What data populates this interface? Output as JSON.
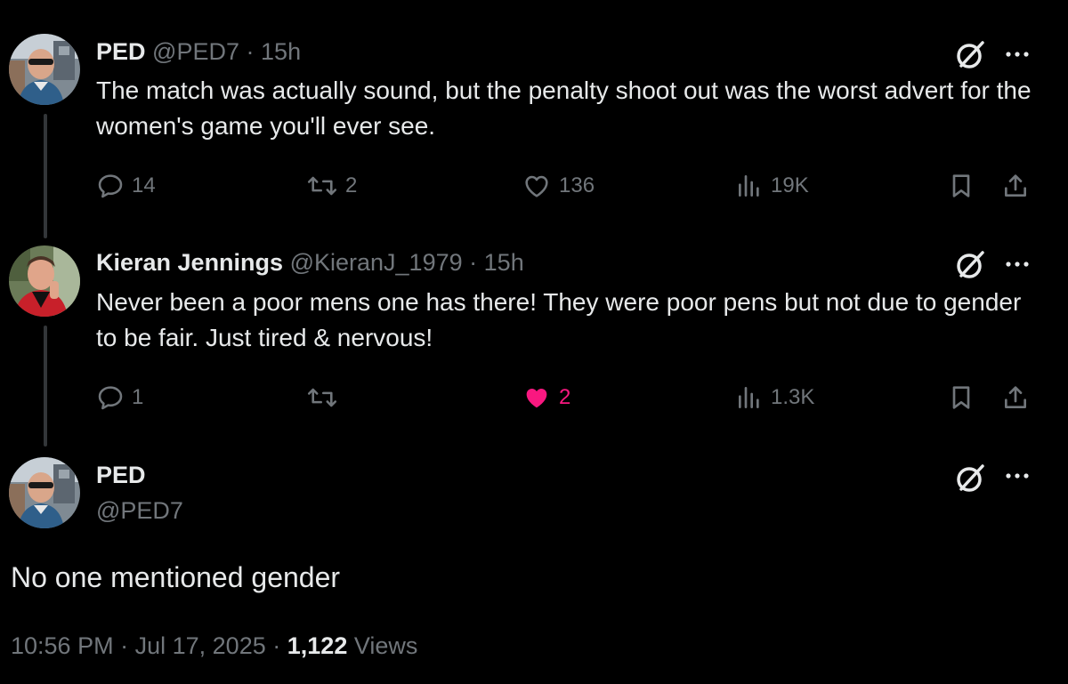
{
  "tweets": [
    {
      "name": "PED",
      "handle": "@PED7",
      "sep": "·",
      "time": "15h",
      "text": "The match was actually sound, but the penalty shoot out was the worst advert for the women's game you'll ever see.",
      "replies": "14",
      "retweets": "2",
      "likes": "136",
      "views": "19K"
    },
    {
      "name": "Kieran Jennings",
      "handle": "@KieranJ_1979",
      "sep": "·",
      "time": "15h",
      "text": "Never been a poor mens one has there! They were poor pens but not due to gender to be fair. Just tired & nervous!",
      "replies": "1",
      "retweets": "",
      "likes": "2",
      "views": "1.3K"
    }
  ],
  "main_tweet": {
    "name": "PED",
    "handle": "@PED7",
    "text": "No one mentioned gender",
    "time": "10:56 PM",
    "sep": "·",
    "date": "Jul 17, 2025",
    "views_count": "1,122",
    "views_label": "Views"
  },
  "icons": {
    "reply": "reply-icon",
    "retweet": "retweet-icon",
    "like": "heart-icon",
    "views": "views-icon",
    "bookmark": "bookmark-icon",
    "share": "share-icon",
    "grok": "grok-icon",
    "more": "more-icon"
  },
  "colors": {
    "background": "#000000",
    "text": "#e7e9ea",
    "muted": "#71767b",
    "like_active": "#f91880"
  }
}
